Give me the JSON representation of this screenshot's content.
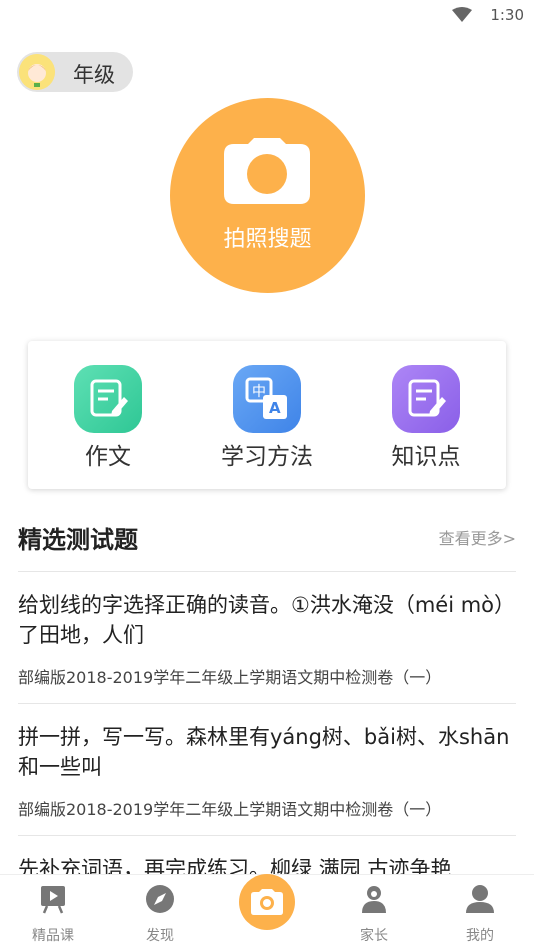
{
  "status": {
    "time": "1:30"
  },
  "header": {
    "grade_label": "年级"
  },
  "camera": {
    "label": "拍照搜题"
  },
  "features": [
    {
      "label": "作文",
      "icon": "essay-icon",
      "color": "#44d3a3"
    },
    {
      "label": "学习方法",
      "icon": "translate-icon",
      "color": "#4f94ef"
    },
    {
      "label": "知识点",
      "icon": "knowledge-icon",
      "color": "#9b6ff0"
    }
  ],
  "section": {
    "title": "精选测试题",
    "more": "查看更多>"
  },
  "questions": [
    {
      "text": "给划线的字选择正确的读音。①洪水淹没（méi mò）了田地，人们",
      "source": "部编版2018-2019学年二年级上学期语文期中检测卷（一）"
    },
    {
      "text": "拼一拼，写一写。森林里有yáng树、bǎi树、水shān和一些叫",
      "source": "部编版2018-2019学年二年级上学期语文期中检测卷（一）"
    },
    {
      "text": "先补充词语，再完成练习。柳绿 满园 古迹争艳"
    }
  ],
  "nav": [
    {
      "label": "精品课",
      "icon": "video-course-icon"
    },
    {
      "label": "发现",
      "icon": "compass-icon"
    },
    {
      "label": "",
      "icon": "camera-icon"
    },
    {
      "label": "家长",
      "icon": "parent-icon"
    },
    {
      "label": "我的",
      "icon": "user-icon"
    }
  ]
}
